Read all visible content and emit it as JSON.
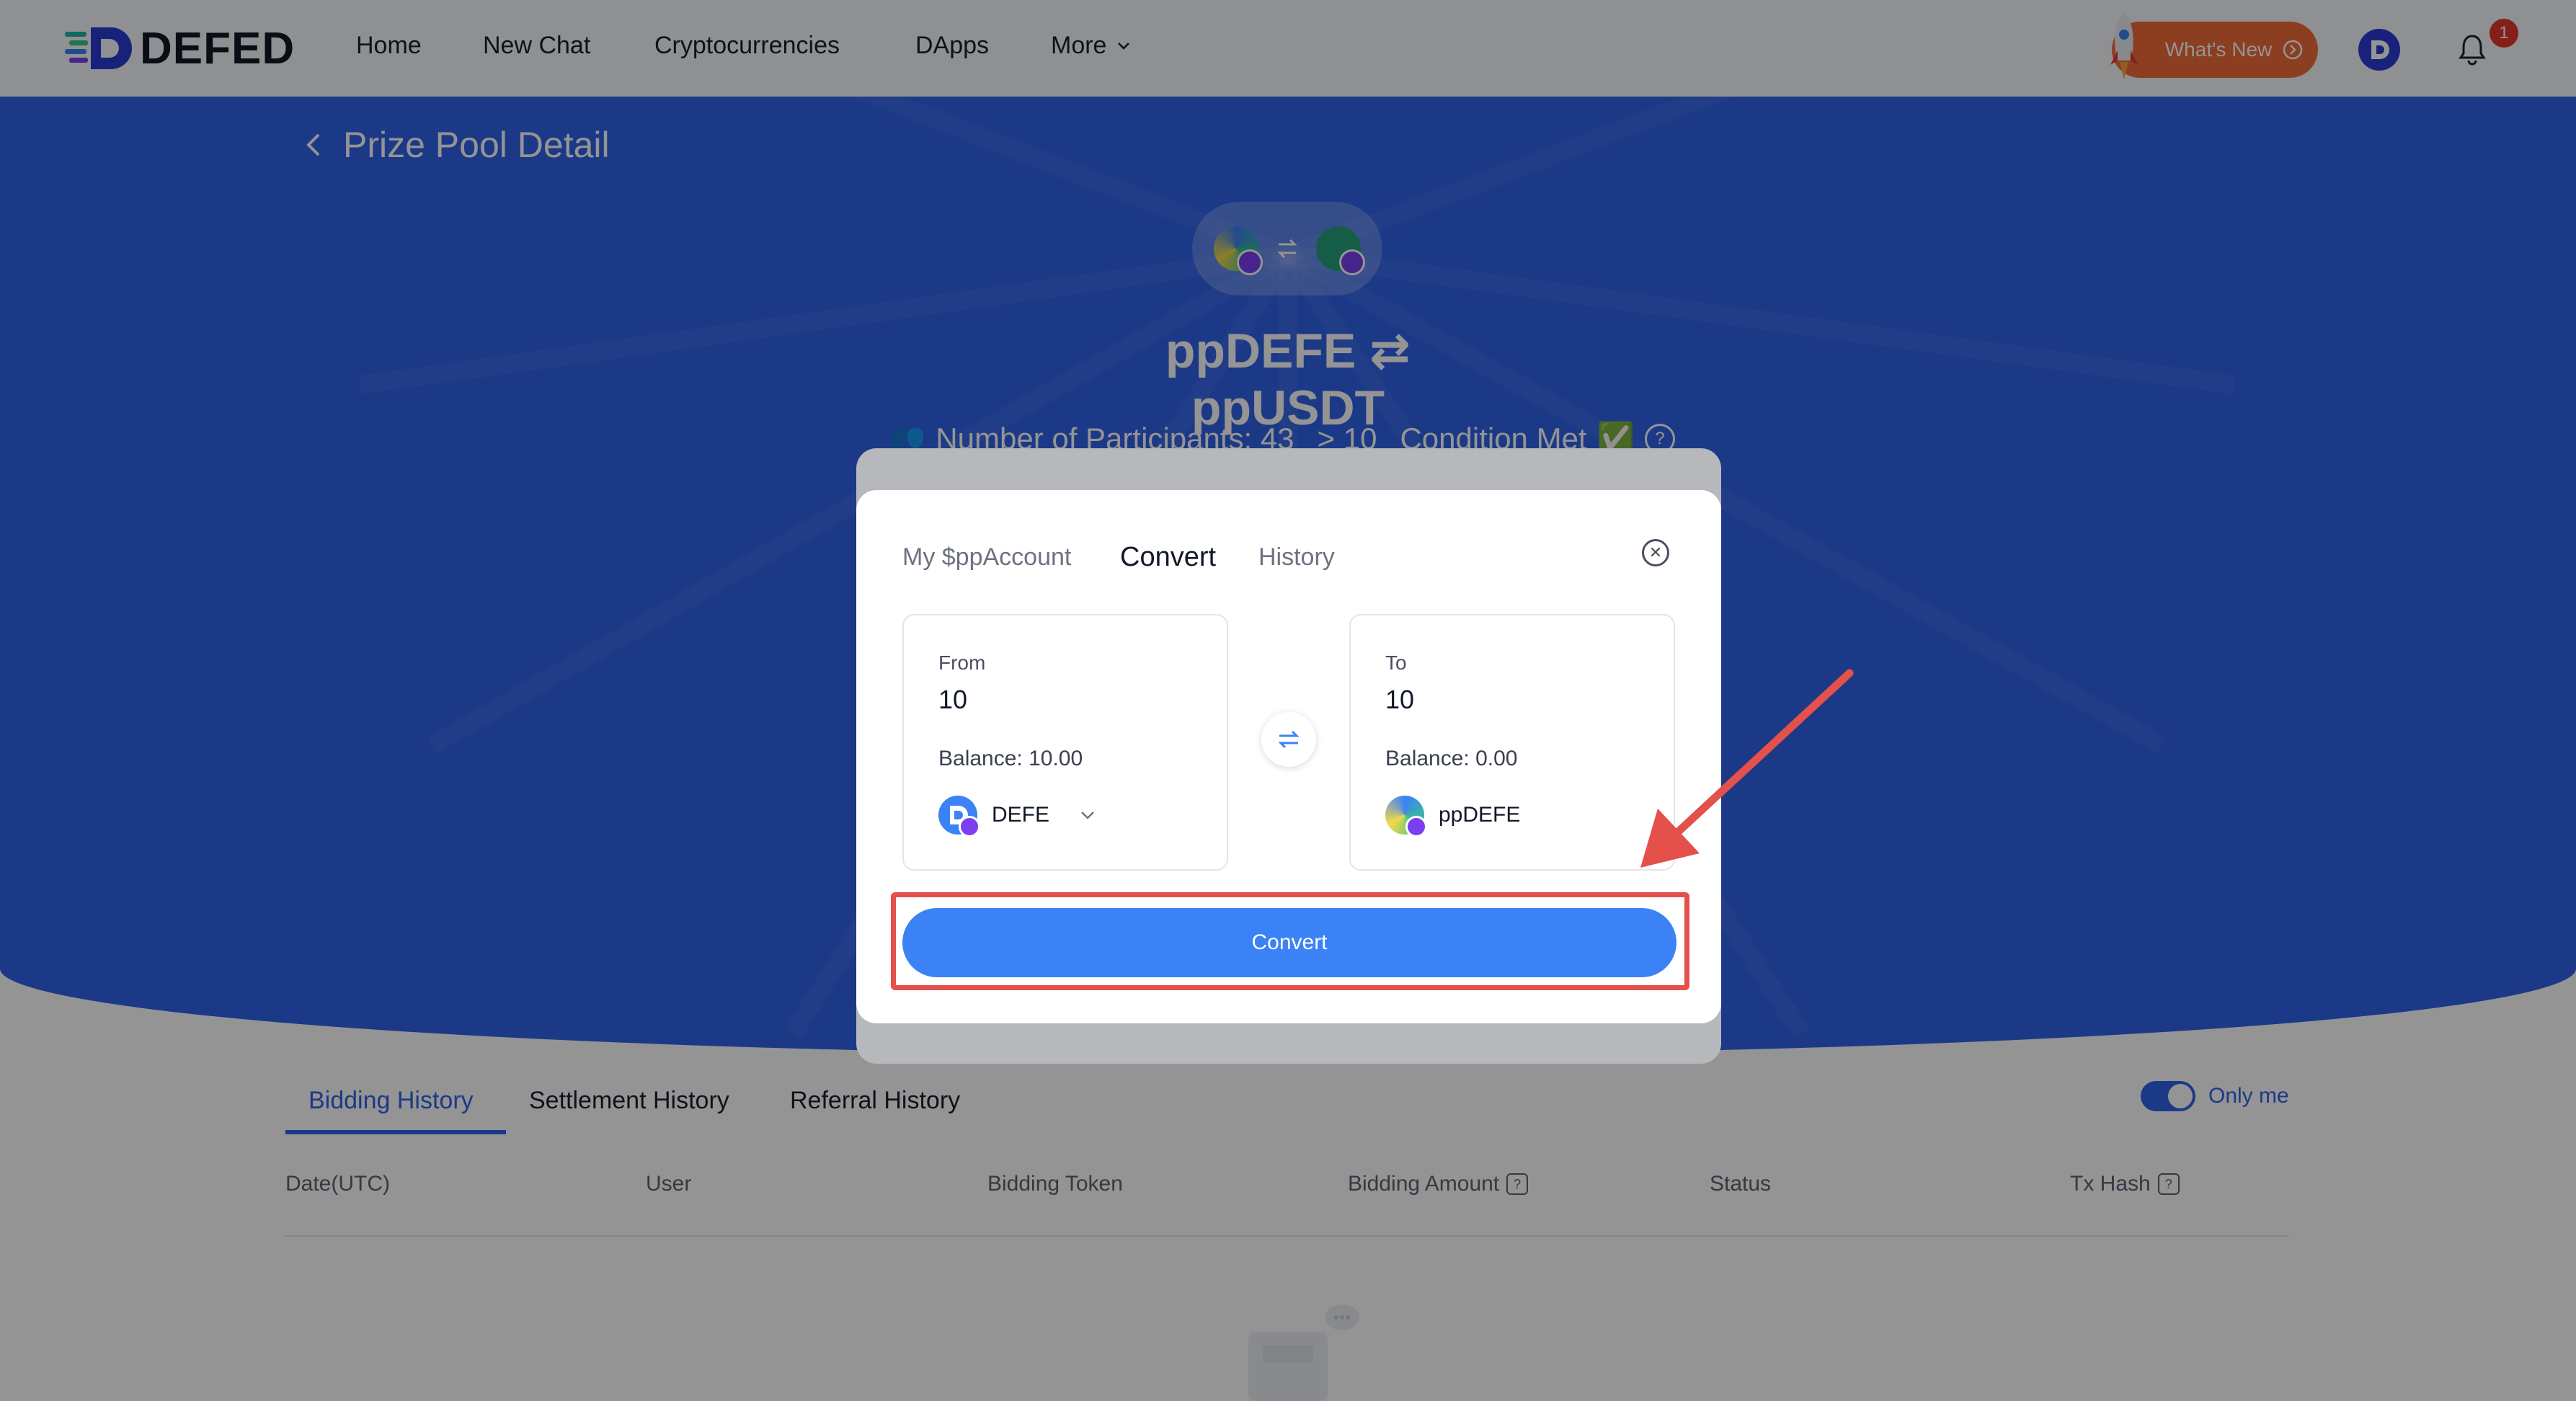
{
  "nav": {
    "logo_text": "DEFED",
    "items": [
      "Home",
      "New Chat",
      "Cryptocurrencies",
      "DApps",
      "More"
    ],
    "whats_new": "What's New",
    "notification_count": "1"
  },
  "page": {
    "title": "Prize Pool Detail",
    "pair_from": "ppDEFE",
    "pair_to": "ppUSDT",
    "participants": "Number of Participants: 43",
    "threshold": "> 10",
    "condition": "Condition Met"
  },
  "history": {
    "tabs": [
      "Bidding History",
      "Settlement History",
      "Referral History"
    ],
    "only_me": "Only me",
    "columns": [
      "Date(UTC)",
      "User",
      "Bidding Token",
      "Bidding Amount",
      "Status",
      "Tx Hash"
    ]
  },
  "modal": {
    "tabs": [
      "My $ppAccount",
      "Convert",
      "History"
    ],
    "from": {
      "label": "From",
      "amount": "10",
      "balance": "Balance: 10.00",
      "token": "DEFE"
    },
    "to": {
      "label": "To",
      "amount": "10",
      "balance": "Balance: 0.00",
      "token": "ppDEFE"
    },
    "convert_label": "Convert"
  },
  "colors": {
    "accent": "#3b82f6",
    "hero_blue": "#2f63e8",
    "highlight_red": "#e4504a",
    "whats_new_orange": "#f26b3a"
  }
}
